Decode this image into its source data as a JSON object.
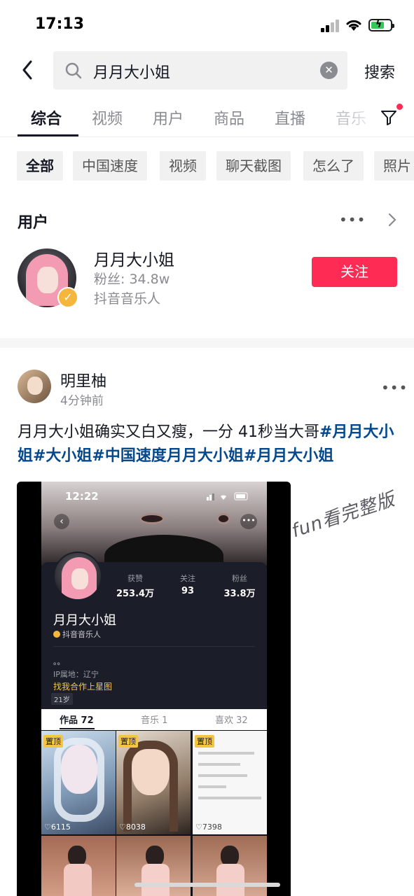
{
  "status_bar": {
    "time": "17:13"
  },
  "search": {
    "query": "月月大小姐",
    "button_label": "搜索"
  },
  "tabs": [
    {
      "label": "综合",
      "active": true
    },
    {
      "label": "视频"
    },
    {
      "label": "用户"
    },
    {
      "label": "商品"
    },
    {
      "label": "直播"
    },
    {
      "label": "音乐"
    }
  ],
  "chips": [
    "全部",
    "中国速度",
    "视频",
    "聊天截图",
    "怎么了",
    "照片"
  ],
  "user_section": {
    "title": "用户",
    "user": {
      "name": "月月大小姐",
      "fans": "粉丝: 34.8w",
      "tag": "抖音音乐人",
      "follow_label": "关注"
    }
  },
  "post": {
    "author": "明里柚",
    "time": "4分钟前",
    "text_plain": "月月大小姐确实又白又瘦，一分 41秒当大哥",
    "hashtags": "#月月大小姐#大小姐#中国速度月月大小姐#月月大小姐",
    "video": {
      "phone_time": "12:22",
      "stats": [
        {
          "label": "获赞",
          "value": "253.4万"
        },
        {
          "label": "关注",
          "value": "93"
        },
        {
          "label": "粉丝",
          "value": "33.8万"
        }
      ],
      "profile_name": "月月大小姐",
      "profile_tag": "抖音音乐人",
      "bio": "。。",
      "ip": "IP属地：辽宁",
      "link": "找我合作上星图",
      "age": "21岁",
      "tabs": [
        "作品 72",
        "音乐 1",
        "喜欢 32"
      ],
      "pin_label": "置顶",
      "thumb_likes": [
        "6115",
        "8038",
        "7398"
      ],
      "watermark": "fun看完整版"
    }
  },
  "colors": {
    "accent": "#fe2c55",
    "hashtag": "#04498d",
    "badge": "#f4b63c"
  }
}
